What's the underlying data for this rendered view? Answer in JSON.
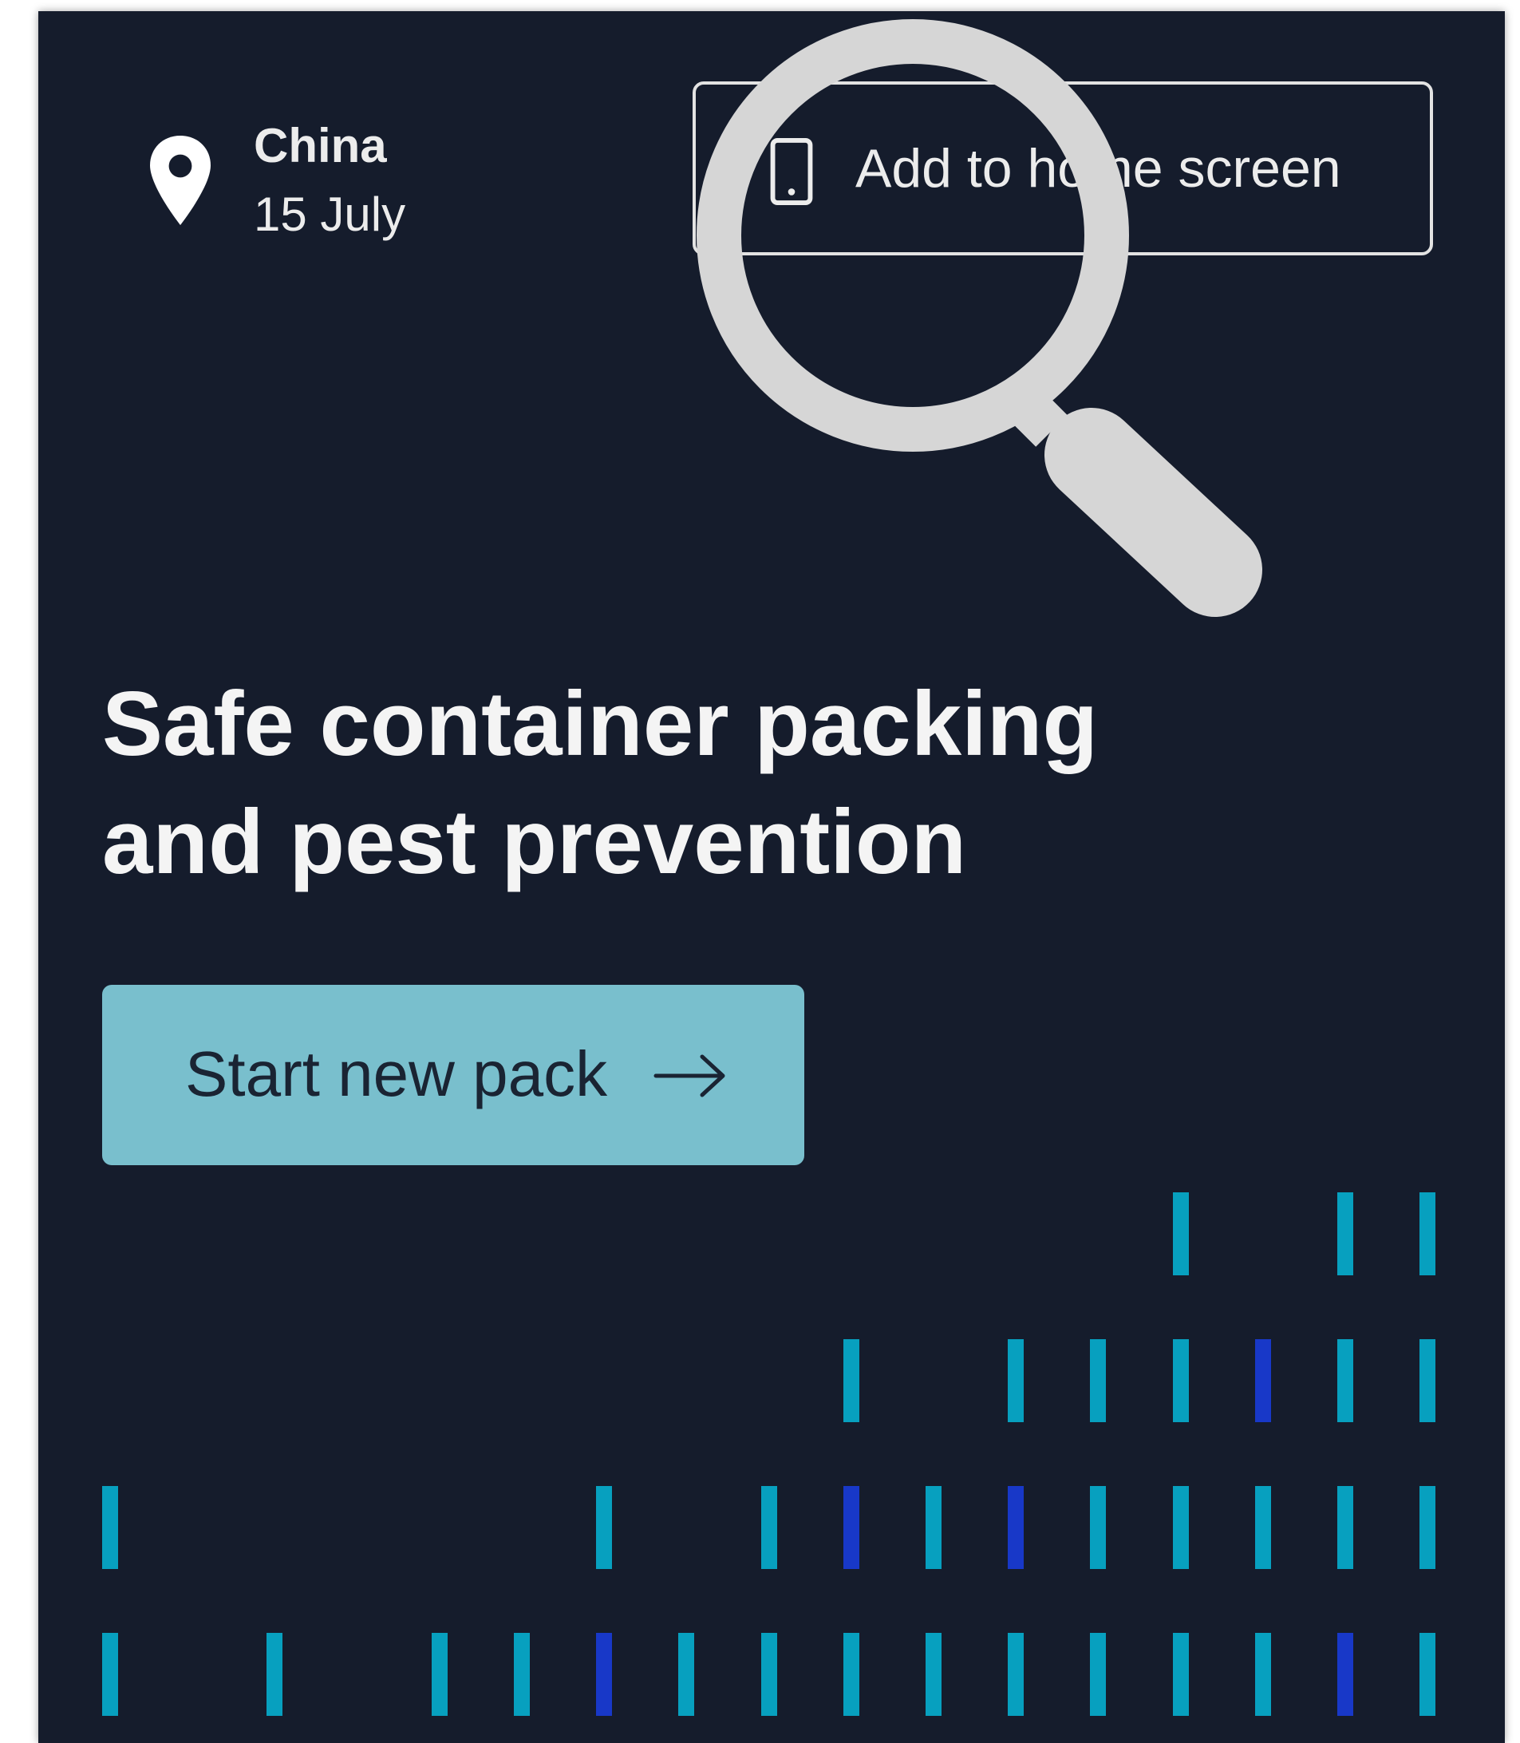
{
  "header": {
    "location_icon": "map-pin-icon",
    "country": "China",
    "date": "15 July",
    "add_home": {
      "label": "Add to home screen",
      "icon": "mobile-phone-icon"
    }
  },
  "overlay": {
    "icon": "magnifying-glass-icon"
  },
  "hero": {
    "title_line1": "Safe container packing",
    "title_line2": "and pest prevention"
  },
  "cta": {
    "label": "Start new pack",
    "icon": "arrow-right-icon"
  },
  "colors": {
    "background": "#151c2c",
    "text": "#ececec",
    "cta_background": "#79bfcd",
    "cta_text": "#1a2433",
    "bar_cyan": "#07a0bf",
    "bar_blue": "#1838c8",
    "magnifier": "#d6d6d6"
  },
  "decoration": {
    "rows": [
      [
        "",
        "",
        "",
        "",
        "",
        "",
        "",
        "",
        "",
        "",
        "",
        "",
        "",
        "c",
        "",
        "c",
        "c"
      ],
      [
        "",
        "",
        "",
        "",
        "",
        "",
        "",
        "",
        "",
        "c",
        "",
        "c",
        "c",
        "c",
        "b",
        "c",
        "c"
      ],
      [
        "c",
        "",
        "",
        "",
        "",
        "",
        "c",
        "",
        "c",
        "b",
        "c",
        "b",
        "c",
        "c",
        "c",
        "c",
        "c"
      ],
      [
        "c",
        "",
        "c",
        "",
        "c",
        "c",
        "b",
        "c",
        "c",
        "c",
        "c",
        "c",
        "c",
        "c",
        "c",
        "b",
        "c"
      ]
    ]
  }
}
